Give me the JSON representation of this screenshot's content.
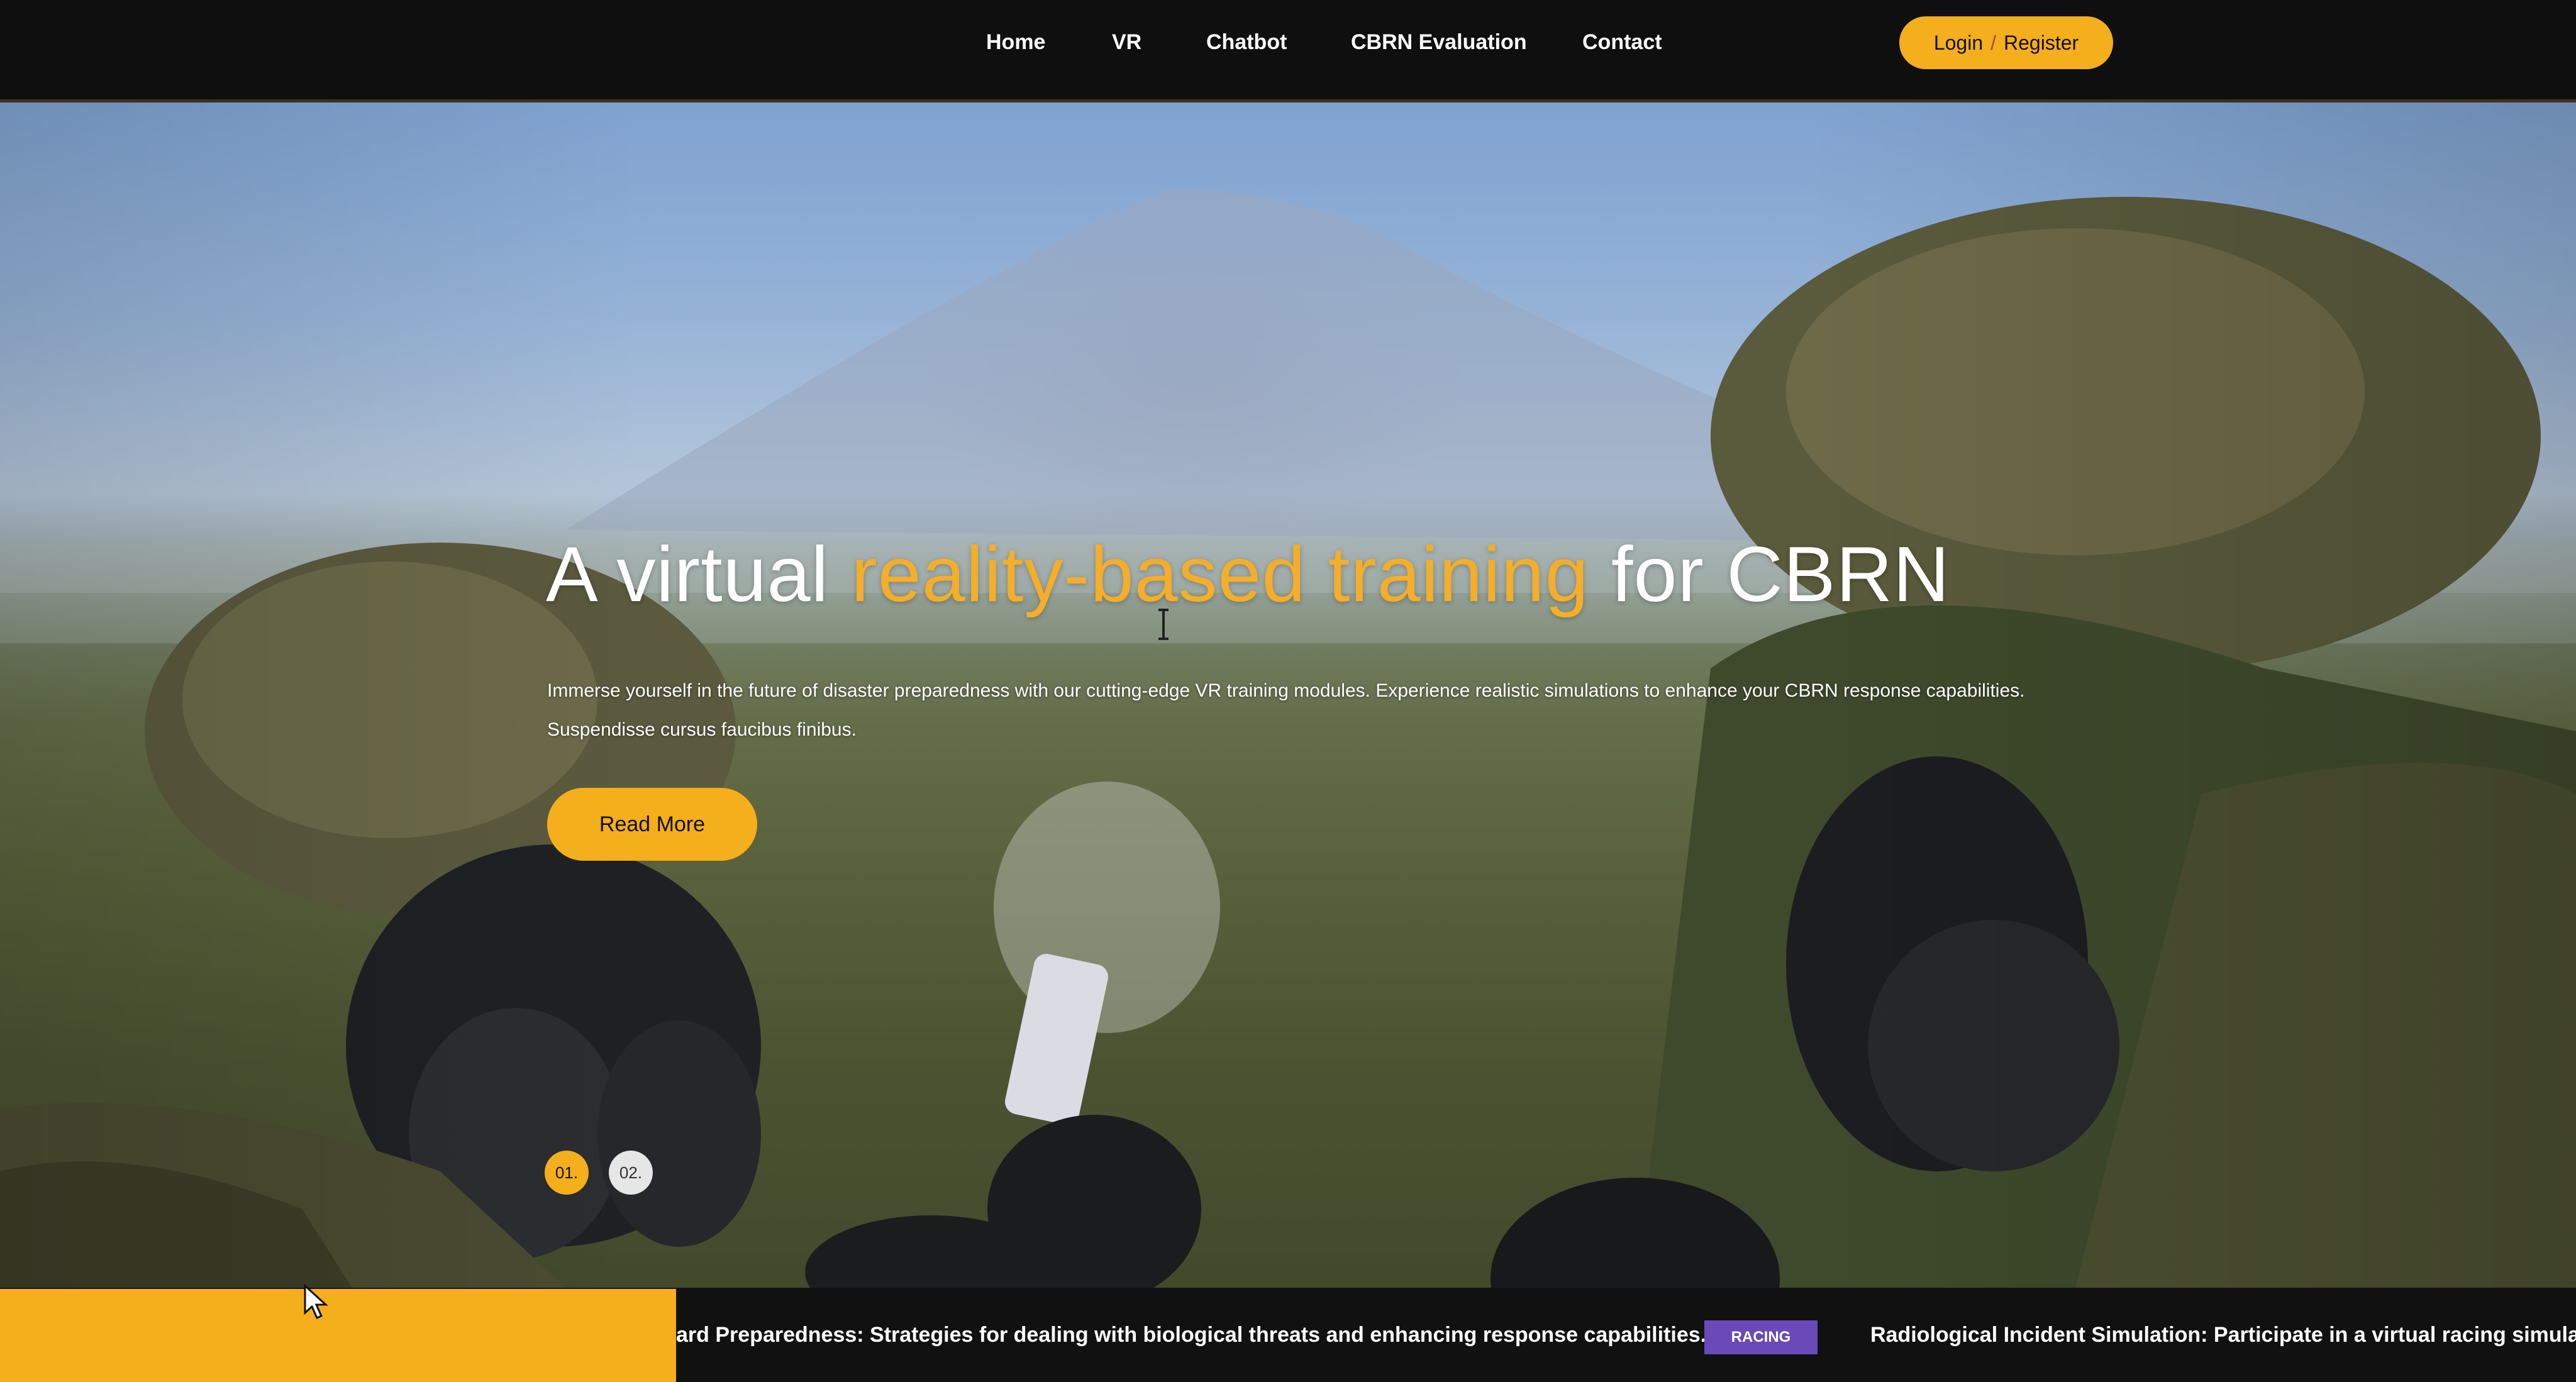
{
  "nav": {
    "links": [
      "Home",
      "VR",
      "Chatbot",
      "CBRN Evaluation",
      "Contact"
    ],
    "auth": {
      "login": "Login",
      "separator": "/",
      "register": "Register"
    }
  },
  "hero": {
    "title_start": "A virtual ",
    "title_accent": "reality-based training",
    "title_end": " for CBRN",
    "description": "Immerse yourself in the future of disaster preparedness with our cutting-edge VR training modules. Experience realistic simulations to enhance your CBRN response capabilities. Suspendisse cursus faucibus finibus.",
    "cta": "Read More",
    "slides": [
      "01.",
      "02."
    ],
    "active_slide": 0
  },
  "ticker": {
    "items": [
      "ard Preparedness: Strategies for dealing with biological threats and enhancing response capabilities.",
      "Radiological Incident Simulation: Participate in a virtual racing simulation"
    ],
    "tag": "RACING"
  },
  "colors": {
    "accent": "#f5ae1c",
    "nav_bg": "#0f0f0f",
    "tag": "#6a49b8"
  }
}
